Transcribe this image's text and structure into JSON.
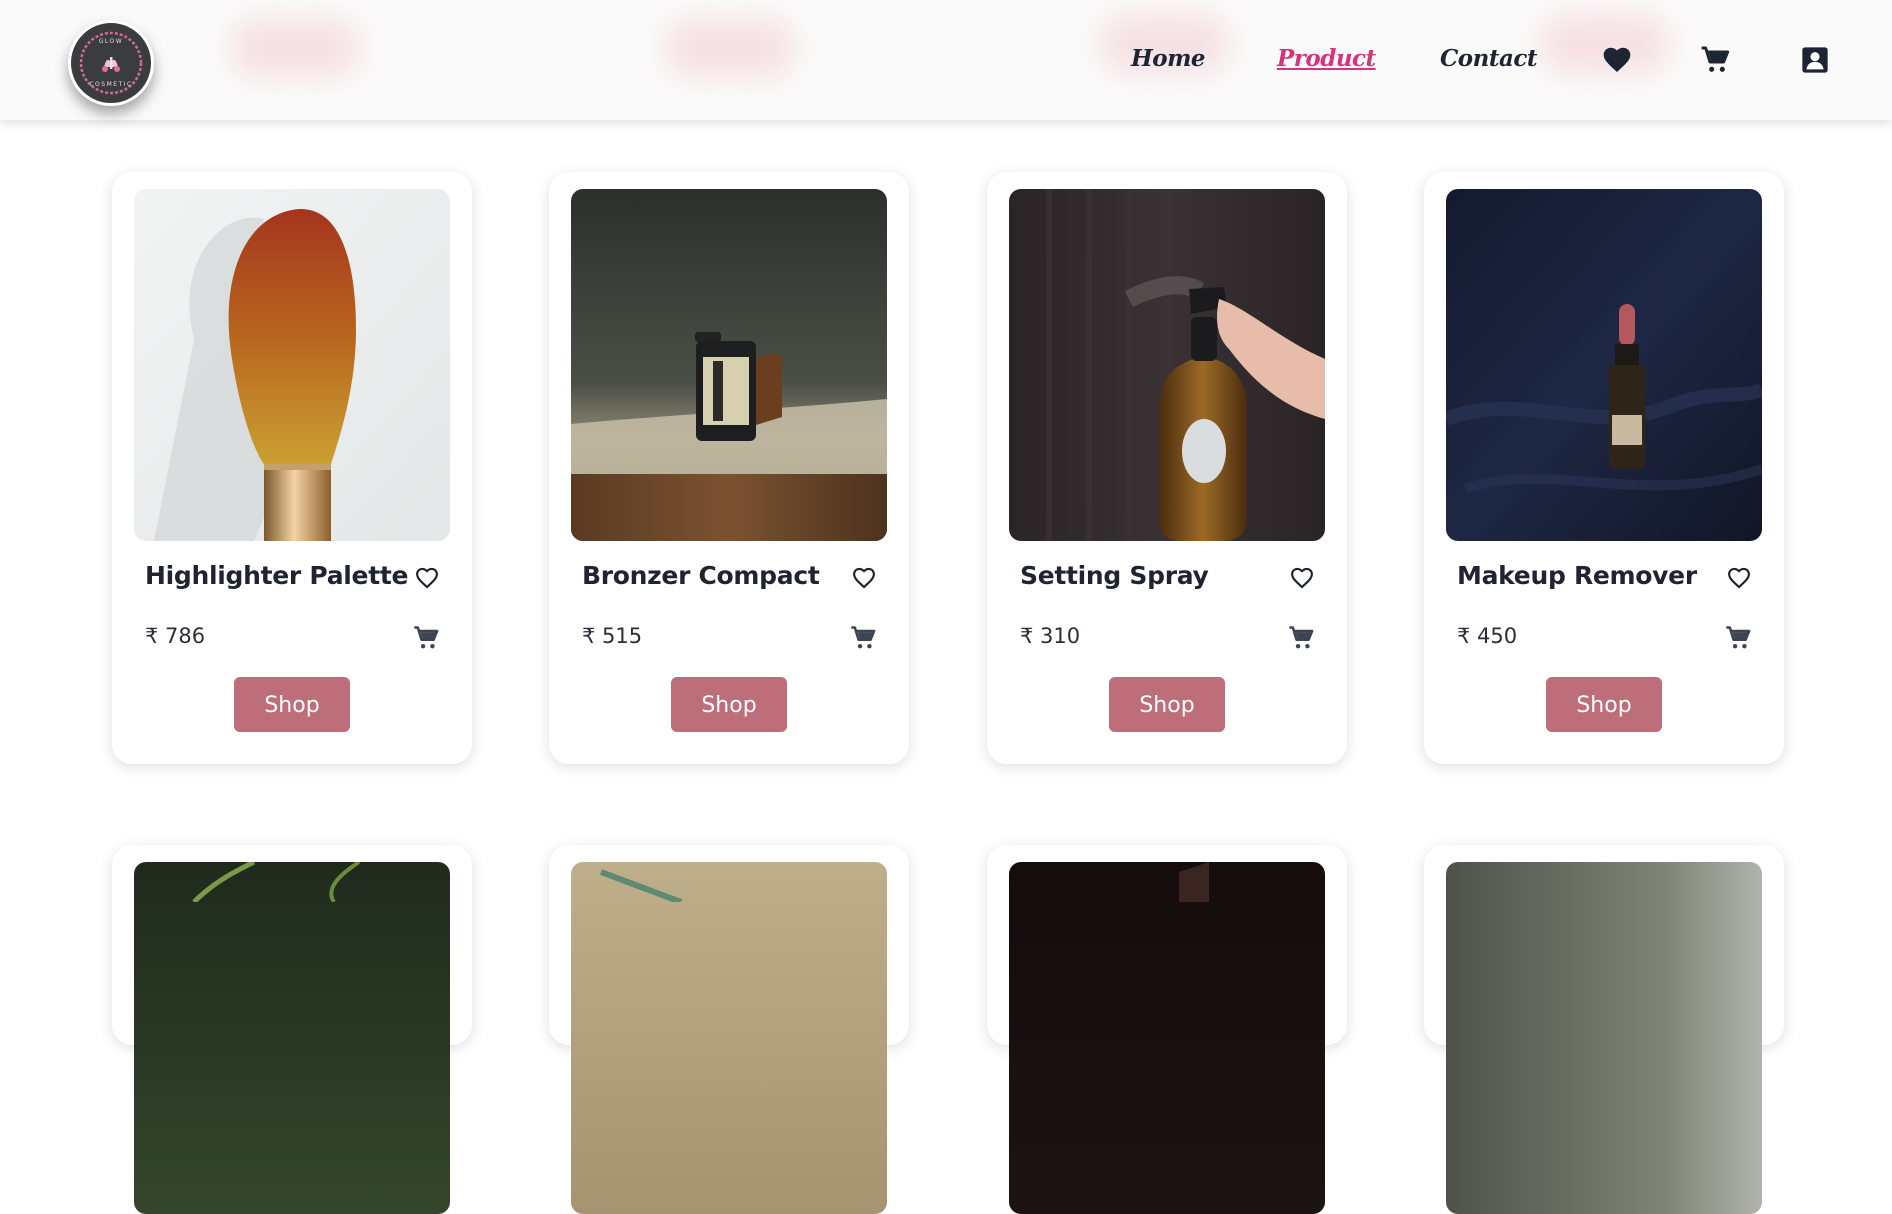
{
  "brand": {
    "logo_top": "GLOW",
    "logo_bottom": "COSMETIC"
  },
  "nav": {
    "home": "Home",
    "product": "Product",
    "contact": "Contact",
    "icons": [
      "heart-icon",
      "cart-icon",
      "user-profile-icon"
    ]
  },
  "colors": {
    "accent": "#d6337a",
    "button": "#bd6e78",
    "text": "#1f2430"
  },
  "products": [
    {
      "name": "Highlighter Palette",
      "price": "₹ 786",
      "button": "Shop",
      "image": "makeup-brush-image"
    },
    {
      "name": "Bronzer Compact",
      "price": "₹ 515",
      "button": "Shop",
      "image": "film-canister-image"
    },
    {
      "name": "Setting Spray",
      "price": "₹ 310",
      "button": "Shop",
      "image": "spray-bottle-image"
    },
    {
      "name": "Makeup Remover",
      "price": "₹ 450",
      "button": "Shop",
      "image": "dropper-bottle-image"
    }
  ]
}
